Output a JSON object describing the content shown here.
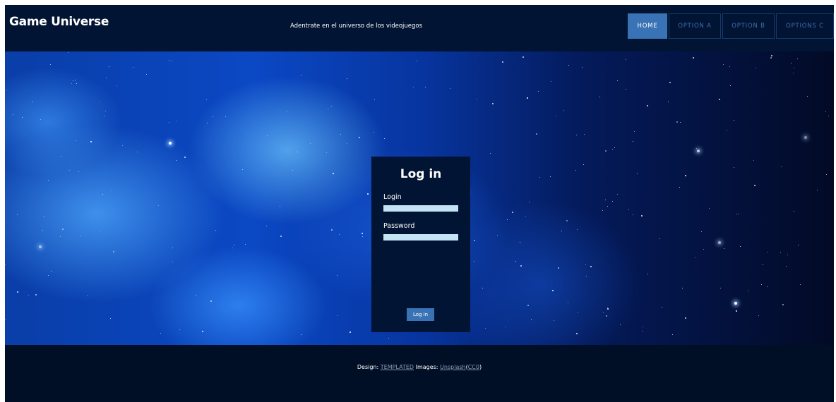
{
  "header": {
    "brand": "Game Universe",
    "tagline": "Adentrate en el universo de los videojuegos",
    "nav": [
      {
        "label": "HOME",
        "active": true
      },
      {
        "label": "OPTION A",
        "active": false
      },
      {
        "label": "OPTION B",
        "active": false
      },
      {
        "label": "OPTIONS C",
        "active": false
      }
    ]
  },
  "login": {
    "title": "Log in",
    "login_label": "Login",
    "login_value": "",
    "password_label": "Password",
    "password_value": "",
    "button_label": "Log in"
  },
  "footer": {
    "design_label": "Design:",
    "design_link": "TEMPLATED",
    "images_label": "Images:",
    "images_link": "Unsplash",
    "paren_open": "(",
    "license_link": "CC0",
    "paren_close": ")"
  },
  "colors": {
    "header_bg": "#021433",
    "page_bg": "#010f26",
    "accent": "#3a73b5",
    "input_bg": "#c4e4f5"
  }
}
